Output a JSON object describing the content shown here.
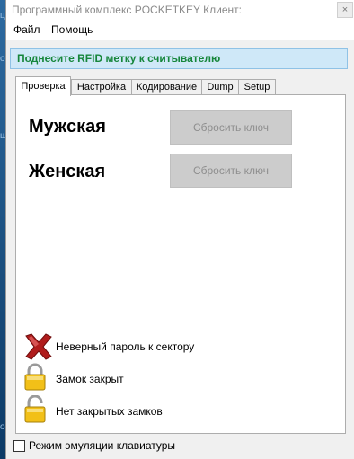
{
  "window": {
    "title": "Программный комплекс POCKETKEY Клиент:",
    "close_label": "×"
  },
  "background": {
    "edge_glyphs": [
      "ци",
      "о",
      "ш",
      "он"
    ]
  },
  "menu": {
    "items": [
      {
        "label": "Файл"
      },
      {
        "label": "Помощь"
      }
    ]
  },
  "status": {
    "message": "Поднесите RFID метку к считывателю",
    "color": "#16863b"
  },
  "tabs": [
    {
      "label": "Проверка",
      "active": true
    },
    {
      "label": "Настройка",
      "active": false
    },
    {
      "label": "Кодирование",
      "active": false
    },
    {
      "label": "Dump",
      "active": false
    },
    {
      "label": "Setup",
      "active": false
    }
  ],
  "check_panel": {
    "male": {
      "label": "Мужская",
      "button_label": "Сбросить ключ"
    },
    "female": {
      "label": "Женская",
      "button_label": "Сбросить ключ"
    },
    "status_items": [
      {
        "icon": "red-x-icon",
        "text": "Неверный пароль к сектору"
      },
      {
        "icon": "lock-closed-icon",
        "text": "Замок закрыт"
      },
      {
        "icon": "lock-open-icon",
        "text": "Нет закрытых замков"
      }
    ]
  },
  "keyboard_emulation": {
    "label": "Режим эмуляции клавиатуры",
    "checked": false
  }
}
